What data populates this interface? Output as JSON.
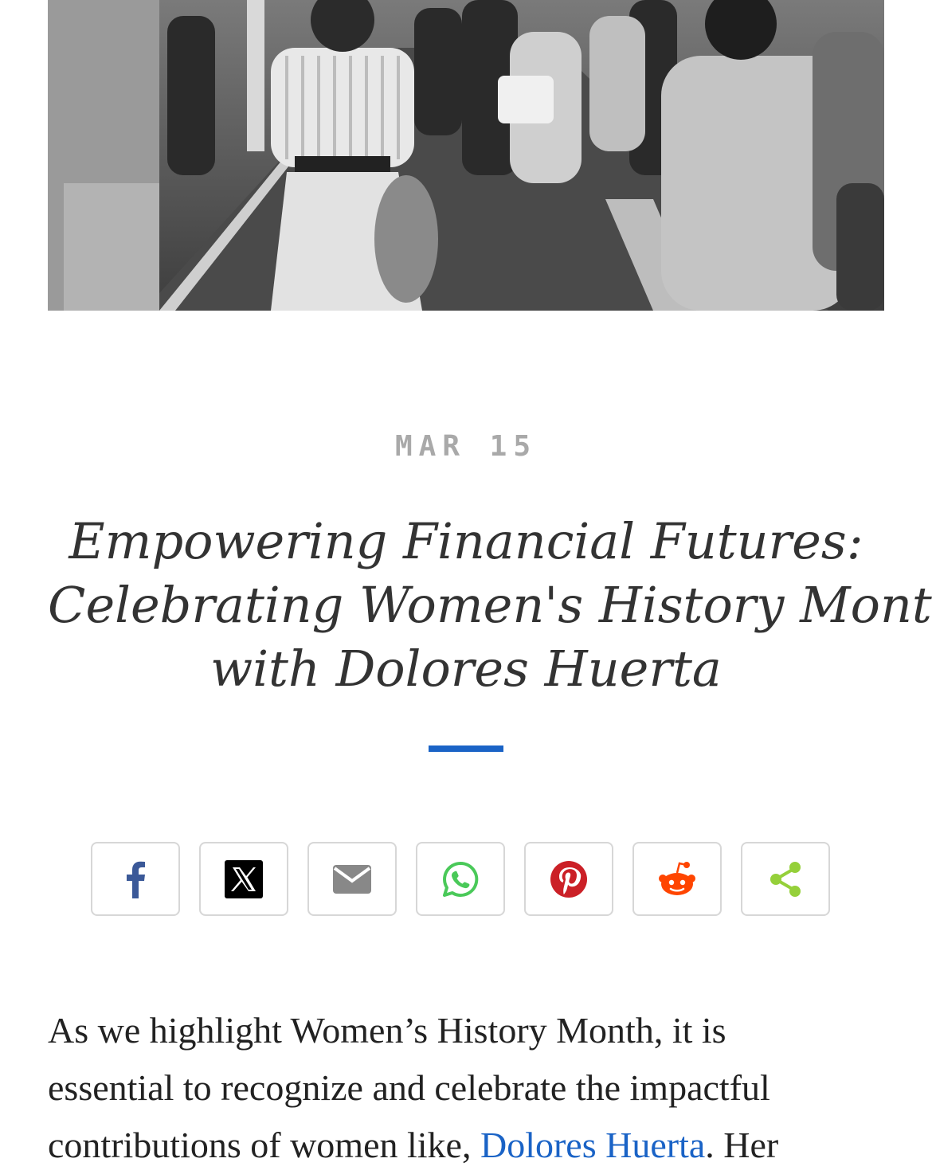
{
  "article": {
    "date": "MAR 15",
    "title_lines": [
      "Empowering Financial Futures:",
      "Celebrating Women's History Month",
      "with Dolores Huerta"
    ],
    "accent_color": "#1a63c6"
  },
  "share": {
    "buttons": [
      {
        "icon": "facebook-icon",
        "color": "#3b5998"
      },
      {
        "icon": "x-icon",
        "color": "#000000"
      },
      {
        "icon": "email-icon",
        "color": "#888888"
      },
      {
        "icon": "whatsapp-icon",
        "color": "#4ac959"
      },
      {
        "icon": "pinterest-icon",
        "color": "#cb2027"
      },
      {
        "icon": "reddit-icon",
        "color": "#ff4500"
      },
      {
        "icon": "share-icon",
        "color": "#95d03a"
      }
    ]
  },
  "body": {
    "line1": "As we highlight Women’s History Month, it is",
    "line2": "essential to recognize and celebrate the impactful",
    "line3_before": "contributions of women like, ",
    "link_text": "Dolores Huerta",
    "line3_after": ". Her"
  }
}
